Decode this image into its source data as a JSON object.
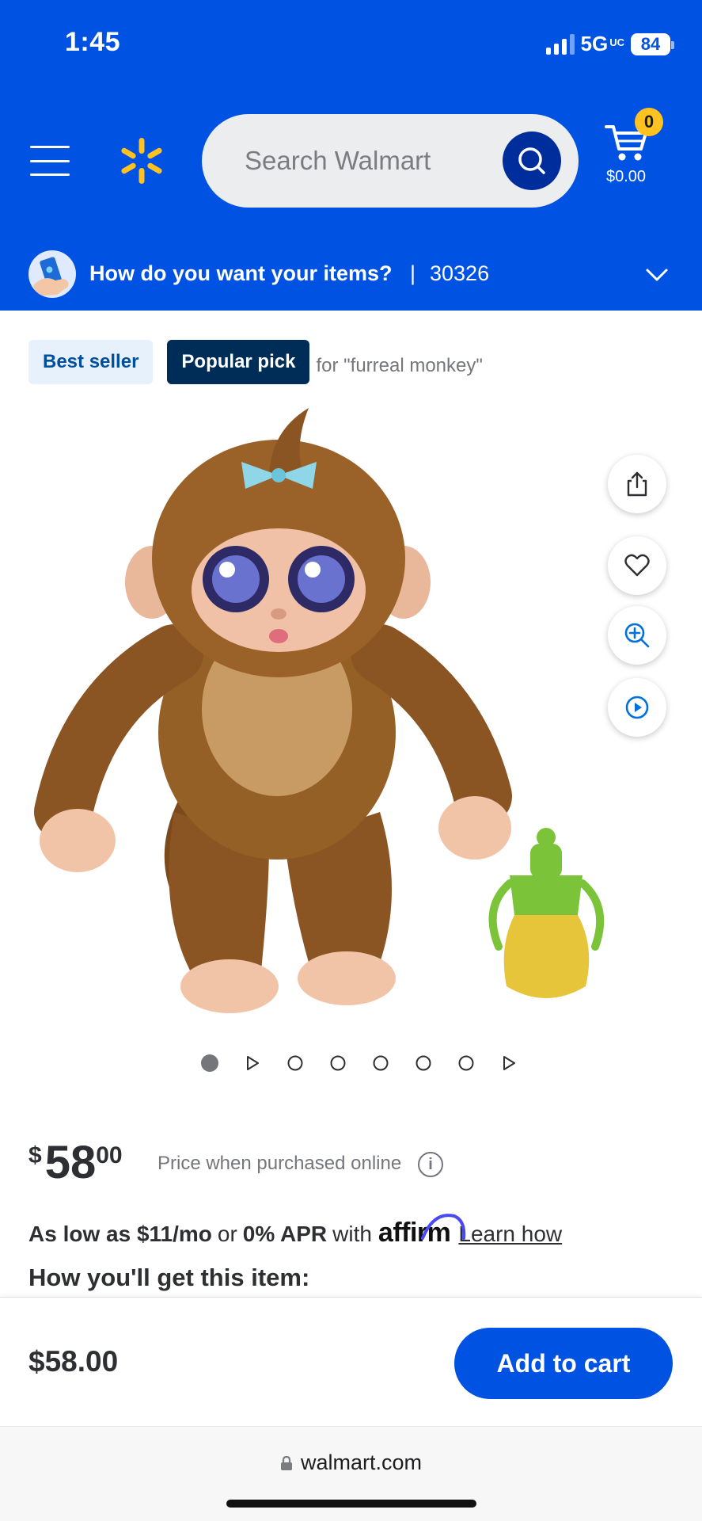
{
  "status": {
    "time": "1:45",
    "network": "5G",
    "network_superscript": "UC",
    "battery": "84"
  },
  "header": {
    "search_placeholder": "Search Walmart",
    "cart_count": "0",
    "cart_total": "$0.00",
    "brand_color": "#0053e2",
    "spark_color": "#ffc220"
  },
  "delivery": {
    "prompt": "How do you want your items?",
    "separator": "|",
    "zip": "30326"
  },
  "badges": {
    "best_seller": "Best seller",
    "popular_pick": "Popular pick",
    "popular_context": "for \"furreal monkey\""
  },
  "media": {
    "side_actions": [
      "share-icon",
      "heart-icon",
      "zoom-in-icon",
      "play-icon"
    ],
    "carousel": {
      "total": 8,
      "active_index": 0
    }
  },
  "price": {
    "currency": "$",
    "whole": "58",
    "cents": "00",
    "note": "Price when purchased online",
    "info_glyph": "i"
  },
  "finance": {
    "as_low_as": "As low as $11/mo",
    "or": "or",
    "apr": "0% APR",
    "with": "with",
    "affirm": "affirm",
    "learn": "Learn how"
  },
  "fulfillment_heading": "How you'll get this item:",
  "bottom_bar": {
    "price": "$58.00",
    "add_to_cart": "Add to cart"
  },
  "browser": {
    "url": "walmart.com"
  }
}
